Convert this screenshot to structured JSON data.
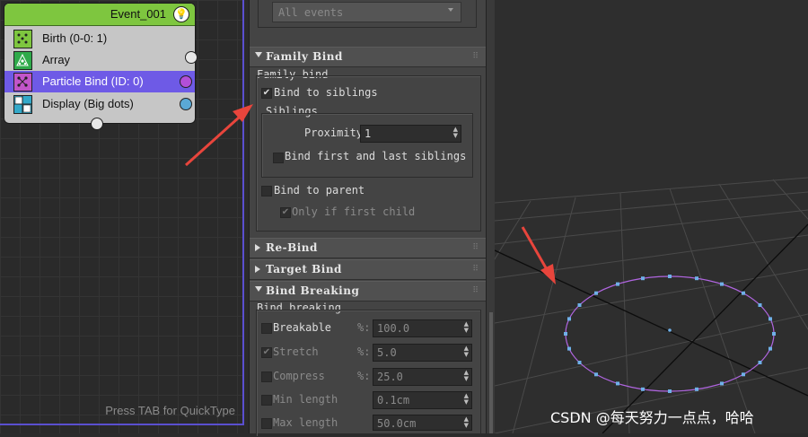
{
  "node_editor": {
    "node": {
      "title": "Event_001",
      "operators": [
        {
          "label": "Birth (0-0: 1)",
          "icon": "birth-icon",
          "color": "#7ec63f"
        },
        {
          "label": "Array",
          "icon": "array-icon",
          "color": "#2faa4a"
        },
        {
          "label": "Particle Bind (ID: 0)",
          "icon": "particle-bind-icon",
          "color": "#c255c9",
          "selected": true
        },
        {
          "label": "Display (Big dots)",
          "icon": "display-icon",
          "color": "#33a9c9"
        }
      ]
    },
    "hint": "Press TAB for QuickType"
  },
  "panel": {
    "events_dropdown": "All events",
    "family_bind": {
      "header": "Family Bind",
      "group_label": "Family bind",
      "bind_to_siblings": {
        "label": "Bind to siblings",
        "checked": true
      },
      "siblings_group": "Siblings",
      "proximity": {
        "label": "Proximity",
        "value": "1"
      },
      "bind_first_last": {
        "label": "Bind first and last siblings",
        "checked": false
      },
      "bind_to_parent": {
        "label": "Bind to parent",
        "checked": false
      },
      "only_if_first_child": {
        "label": "Only if first child",
        "checked": true
      }
    },
    "re_bind": {
      "header": "Re-Bind"
    },
    "target_bind": {
      "header": "Target Bind"
    },
    "bind_breaking": {
      "header": "Bind Breaking",
      "group_label": "Bind breaking",
      "rows": [
        {
          "label": "Breakable",
          "unit": "%:",
          "value": "100.0",
          "checked": false
        },
        {
          "label": "Stretch",
          "unit": "%:",
          "value": "5.0",
          "checked": true
        },
        {
          "label": "Compress",
          "unit": "%:",
          "value": "25.0",
          "checked": false
        },
        {
          "label": "Min length",
          "unit": "",
          "value": "0.1cm",
          "checked": false
        },
        {
          "label": "Max length",
          "unit": "",
          "value": "50.0cm",
          "checked": false
        }
      ]
    }
  },
  "watermark": "CSDN @每天努力一点点，哈哈",
  "colors": {
    "selection": "#6e5ae6",
    "ring": "#b065e0",
    "arrow": "#e8453c",
    "node_header": "#7ec63f"
  }
}
